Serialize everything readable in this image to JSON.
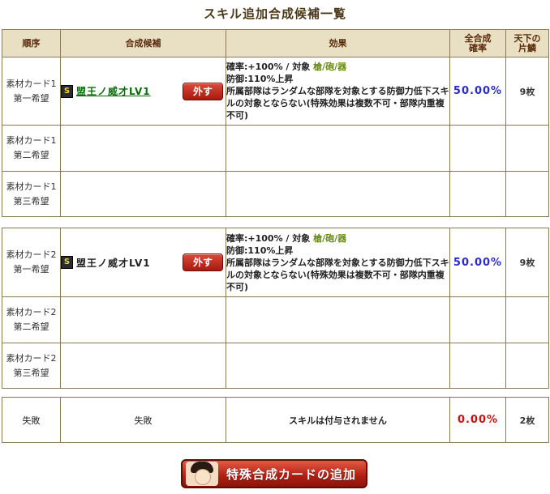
{
  "title": "スキル追加合成候補一覧",
  "headers": {
    "order": "順序",
    "candidate": "合成候補",
    "effect": "効果",
    "rate": "全合成\n確率",
    "pieces": "天下の\n片鱗"
  },
  "group1": {
    "rows": [
      {
        "order": "素材カード1\n第一希望",
        "skill_badge": "S",
        "skill_name": "盟王ノ威才LV1",
        "remove_label": "外す",
        "effect_line1_prefix": "確率:+100% / 対象 ",
        "effect_target": "槍/砲/器",
        "effect_line2": "防御:110%上昇",
        "effect_line3": "所属部隊はランダムな部隊を対象とする防御力低下スキルの対象とならない(特殊効果は複数不可・部隊内重複不可)",
        "rate": "50.00%",
        "pieces": "9枚"
      },
      {
        "order": "素材カード1\n第二希望"
      },
      {
        "order": "素材カード1\n第三希望"
      }
    ]
  },
  "group2": {
    "rows": [
      {
        "order": "素材カード2\n第一希望",
        "skill_badge": "S",
        "skill_name": "盟王ノ威才LV1",
        "remove_label": "外す",
        "effect_line1_prefix": "確率:+100% / 対象 ",
        "effect_target": "槍/砲/器",
        "effect_line2": "防御:110%上昇",
        "effect_line3": "所属部隊はランダムな部隊を対象とする防御力低下スキルの対象とならない(特殊効果は複数不可・部隊内重複不可)",
        "rate": "50.00%",
        "pieces": "9枚"
      },
      {
        "order": "素材カード2\n第二希望"
      },
      {
        "order": "素材カード2\n第三希望"
      }
    ]
  },
  "failure": {
    "order": "失敗",
    "candidate": "失敗",
    "effect": "スキルは付与されません",
    "rate": "0.00%",
    "pieces": "2枚"
  },
  "add_button": {
    "label": "特殊合成カードの追加",
    "icon": "portrait-icon"
  },
  "colors": {
    "header_bg": "#e9dfc3",
    "border": "#8a7a5a",
    "rate_blue": "#2b2bd0",
    "rate_red": "#cc1111",
    "skill_link": "#0a6a0a",
    "target_green": "#6a8a1a",
    "button_red": "#b01e12"
  }
}
